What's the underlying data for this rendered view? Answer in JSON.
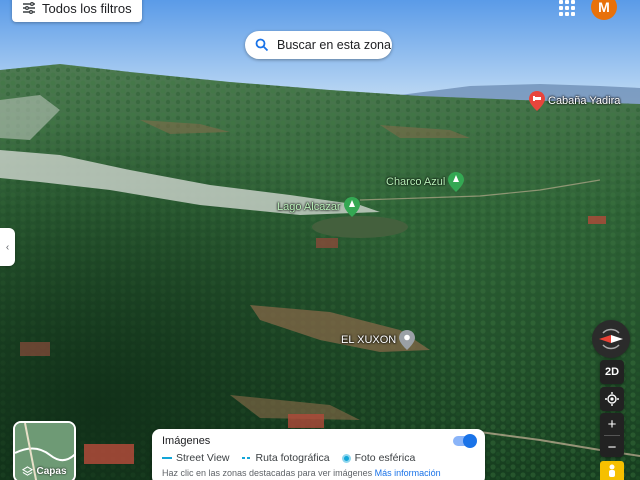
{
  "toolbar": {
    "filters_label": "Todos los filtros",
    "avatar_letter": "M",
    "search_area_label": "Buscar en esta zona"
  },
  "places": [
    {
      "name": "Cabaña Yadira",
      "icon": "lodging-pin-icon",
      "color": "#e8453c"
    },
    {
      "name": "Charco Azul",
      "icon": "park-pin-icon",
      "color": "#34a853"
    },
    {
      "name": "Lago Alcazar",
      "icon": "park-pin-icon",
      "color": "#34a853"
    },
    {
      "name": "EL XUXON",
      "icon": "place-pin-icon",
      "color": "#9aa0a6"
    }
  ],
  "controls": {
    "view_2d_label": "2D",
    "zoom_in": "+",
    "zoom_out": "−"
  },
  "layers": {
    "label": "Capas"
  },
  "imagery": {
    "title": "Imágenes",
    "legend": [
      {
        "label": "Street View",
        "icon": "line-swatch"
      },
      {
        "label": "Ruta fotográfica",
        "icon": "dashed-line-swatch"
      },
      {
        "label": "Foto esférica",
        "icon": "dot-swatch"
      }
    ],
    "hint": "Haz clic en las zonas destacadas para ver imágenes",
    "more_link": "Más información",
    "toggle_on": true
  },
  "colors": {
    "accent": "#1a73e8",
    "avatar": "#e8710a",
    "street_view": "#13a6d8"
  }
}
